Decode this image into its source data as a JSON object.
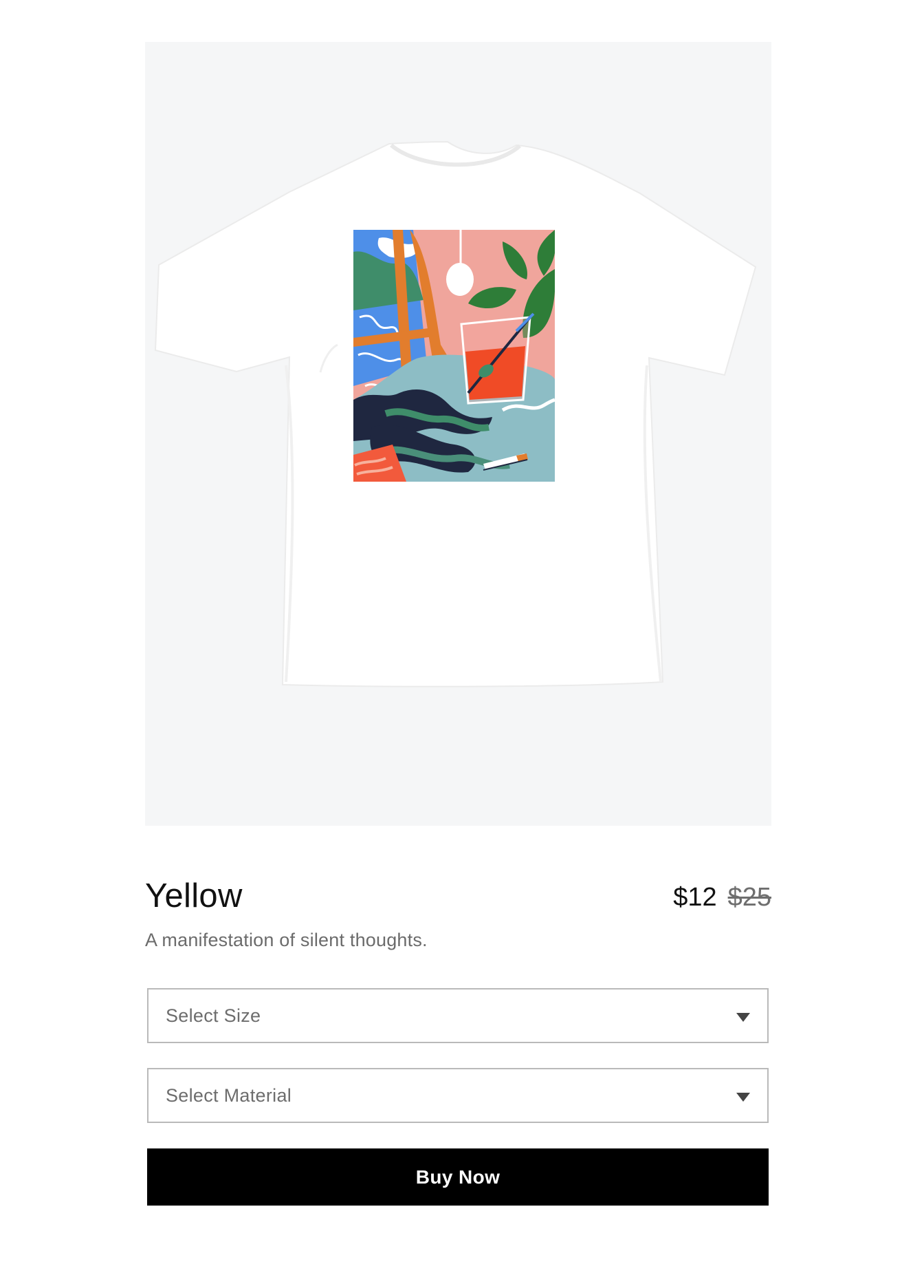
{
  "product": {
    "title": "Yellow",
    "description": "A manifestation of silent thoughts.",
    "price_current": "$12",
    "price_original": "$25",
    "image_icon": "tshirt-print-image"
  },
  "selects": {
    "size_placeholder": "Select Size",
    "material_placeholder": "Select Material"
  },
  "actions": {
    "buy_label": "Buy Now"
  },
  "colors": {
    "image_background": "#f5f6f7",
    "button_background": "#000000",
    "button_text": "#ffffff",
    "select_border": "#b9b9b9"
  }
}
